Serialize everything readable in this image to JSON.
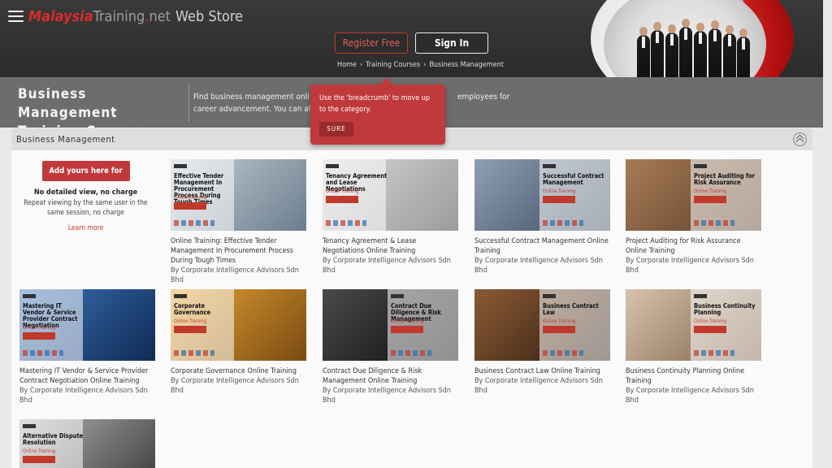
{
  "header": {
    "logo": {
      "part1": "Malaysia",
      "part2": "Training",
      "part3": ".",
      "part4": "net",
      "part5": "Web Store"
    },
    "register_label": "Register Free",
    "signin_label": "Sign In",
    "breadcrumb": [
      "Home",
      "Training Courses",
      "Business Management"
    ]
  },
  "band": {
    "title_line1": "Business Management",
    "title_line2": "Training Courses",
    "desc_line1a": "Find business management onli",
    "desc_line1b": "employees for",
    "desc_line2": "career advancement. You can also"
  },
  "tooltip": {
    "text": "Use the 'breadcrumb' to move up to the category.",
    "button_label": "SURE"
  },
  "panel": {
    "title": "Business Management",
    "promo": {
      "button_label": "Add yours here for FREE",
      "line1": "No detailed view, no charge",
      "line2": "Repeat viewing by the same user in the same session, no charge",
      "link_label": "Learn more"
    },
    "courses": [
      {
        "title": "Online Training: Effective Tender Management In Procurement Process During Tough Times",
        "by": "By Corporate Intelligence Advisors Sdn Bhd",
        "thumb_title": "Effective Tender Management In Procurement Process During Tough Times",
        "thumb_sub": "Online Training",
        "palette": [
          "#c7cfd6",
          "#6b7e8e"
        ]
      },
      {
        "title": "Tenancy Agreement & Lease Negotiations Online Training",
        "by": "By Corporate Intelligence Advisors Sdn Bhd",
        "thumb_title": "Tenancy Agreement and Lease Negotiations",
        "thumb_sub": "Online Training",
        "palette": [
          "#d8d8d8",
          "#9b9b9b"
        ]
      },
      {
        "title": "Successful Contract Management Online Training",
        "by": "By Corporate Intelligence Advisors Sdn Bhd",
        "thumb_title": "Successful Contract Management",
        "thumb_sub": "Online Training",
        "palette": [
          "#8ea0b5",
          "#3b4a5e"
        ]
      },
      {
        "title": "Project Auditing for Risk Assurance Online Training",
        "by": "By Corporate Intelligence Advisors Sdn Bhd",
        "thumb_title": "Project Auditing for Risk Assurance",
        "thumb_sub": "Online Training",
        "palette": [
          "#a77b56",
          "#5a3e28"
        ]
      },
      {
        "title": "Mastering IT Vendor & Service Provider Contract Negotiation Online Training",
        "by": "By Corporate Intelligence Advisors Sdn Bhd",
        "thumb_title": "Mastering IT Vendor & Service Provider Contract Negotiation",
        "thumb_sub": "Online Training",
        "palette": [
          "#3c74b8",
          "#102a55"
        ]
      },
      {
        "title": "Corporate Governance Online Training",
        "by": "By Corporate Intelligence Advisors Sdn Bhd",
        "thumb_title": "Corporate Governance",
        "thumb_sub": "Online Training",
        "palette": [
          "#e5a536",
          "#7a4a12"
        ]
      },
      {
        "title": "Contract Due Diligence & Risk Management Online Training",
        "by": "By Corporate Intelligence Advisors Sdn Bhd",
        "thumb_title": "Contract Due Diligence & Risk Management",
        "thumb_sub": "Online Training",
        "palette": [
          "#4a4a4a",
          "#0c0c0c"
        ]
      },
      {
        "title": "Business Contract Law Online Training",
        "by": "By Corporate Intelligence Advisors Sdn Bhd",
        "thumb_title": "Business Contract Law",
        "thumb_sub": "Online Training",
        "palette": [
          "#8a5a34",
          "#2c1a0e"
        ]
      },
      {
        "title": "Business Continuity Planning Online Training",
        "by": "By Corporate Intelligence Advisors Sdn Bhd",
        "thumb_title": "Business Continuity Planning",
        "thumb_sub": "Online Training",
        "palette": [
          "#d8c3ad",
          "#7b5f45"
        ]
      },
      {
        "title": "",
        "by": "",
        "thumb_title": "Alternative Dispute Resolution",
        "thumb_sub": "Online Training",
        "palette": [
          "#b5b5b5",
          "#3a3a3a"
        ]
      }
    ]
  }
}
